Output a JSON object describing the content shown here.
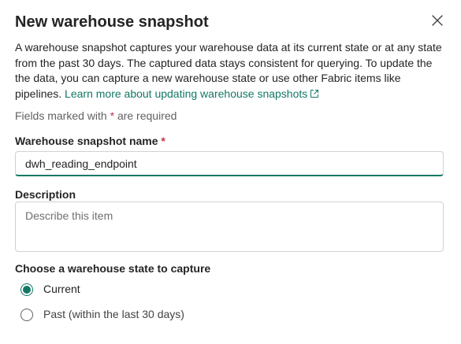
{
  "dialog": {
    "title": "New warehouse snapshot",
    "description_text": "A warehouse snapshot captures your warehouse data at its current state or at any state from the past 30 days. The captured data stays consistent for querying. To update the the data, you can capture a new warehouse state or use other Fabric items like pipelines.",
    "learn_more_link": "Learn more about updating warehouse snapshots",
    "required_note_prefix": "Fields marked with",
    "required_note_asterisk": "*",
    "required_note_suffix": "are required"
  },
  "form": {
    "name_label": "Warehouse snapshot name",
    "name_required_marker": "*",
    "name_value": "dwh_reading_endpoint",
    "description_label": "Description",
    "description_placeholder": "Describe this item",
    "description_value": "",
    "state_label": "Choose a warehouse state to capture",
    "state_options": [
      {
        "label": "Current",
        "selected": true
      },
      {
        "label": "Past (within the last 30 days)",
        "selected": false
      }
    ]
  },
  "icons": {
    "close": "close-icon",
    "external_link": "external-link-icon"
  },
  "colors": {
    "accent": "#117865",
    "required": "#c4314b",
    "text": "#242424",
    "muted_text": "#616161"
  }
}
